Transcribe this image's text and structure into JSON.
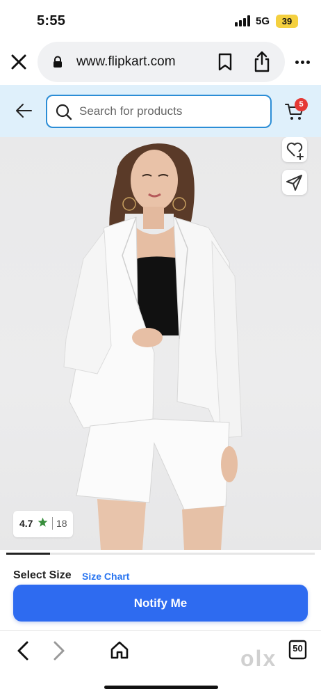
{
  "status_bar": {
    "time": "5:55",
    "network": "5G",
    "battery": "39"
  },
  "browser": {
    "url": "www.flipkart.com"
  },
  "header": {
    "search_placeholder": "Search for products",
    "cart_count": "5"
  },
  "product": {
    "rating": "4.7",
    "rating_count": "18",
    "select_size_label": "Select Size",
    "size_chart_label": "Size Chart",
    "notify_label": "Notify Me",
    "image_position": 1,
    "image_total": 7
  },
  "toolbar": {
    "tab_count": "50"
  },
  "watermark": "olx",
  "colors": {
    "header_bg": "#dff0fb",
    "search_border": "#2b8dd6",
    "cart_badge": "#e53935",
    "notify_button": "#2e6bf0",
    "size_chart_link": "#2874f0",
    "rating_star": "#388e3c",
    "battery": "#f4d03f"
  }
}
